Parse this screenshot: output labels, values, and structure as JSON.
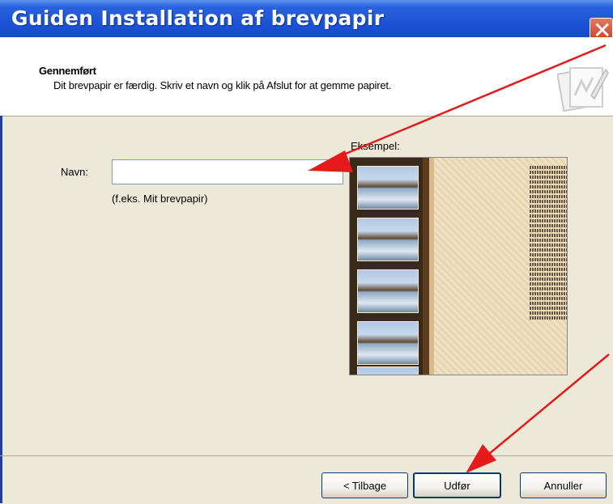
{
  "window": {
    "title": "Guiden Installation af brevpapir",
    "close_glyph": "✕"
  },
  "header": {
    "title": "Gennemført",
    "subtitle": "Dit brevpapir er færdig. Skriv et navn og klik på Afslut for at gemme papiret.",
    "icon": "stationery-wizard-icon"
  },
  "form": {
    "name_label": "Navn:",
    "name_value": "",
    "name_hint": "(f.eks. Mit brevpapir)",
    "example_label": "Eksempel:"
  },
  "buttons": {
    "back": "< Tilbage",
    "finish": "Udfør",
    "cancel": "Annuller"
  },
  "annotations": {
    "arrow_color": "#e51b1b"
  },
  "colors": {
    "titlebar": "#1d55d6",
    "dialog_bg": "#ece9d8"
  }
}
